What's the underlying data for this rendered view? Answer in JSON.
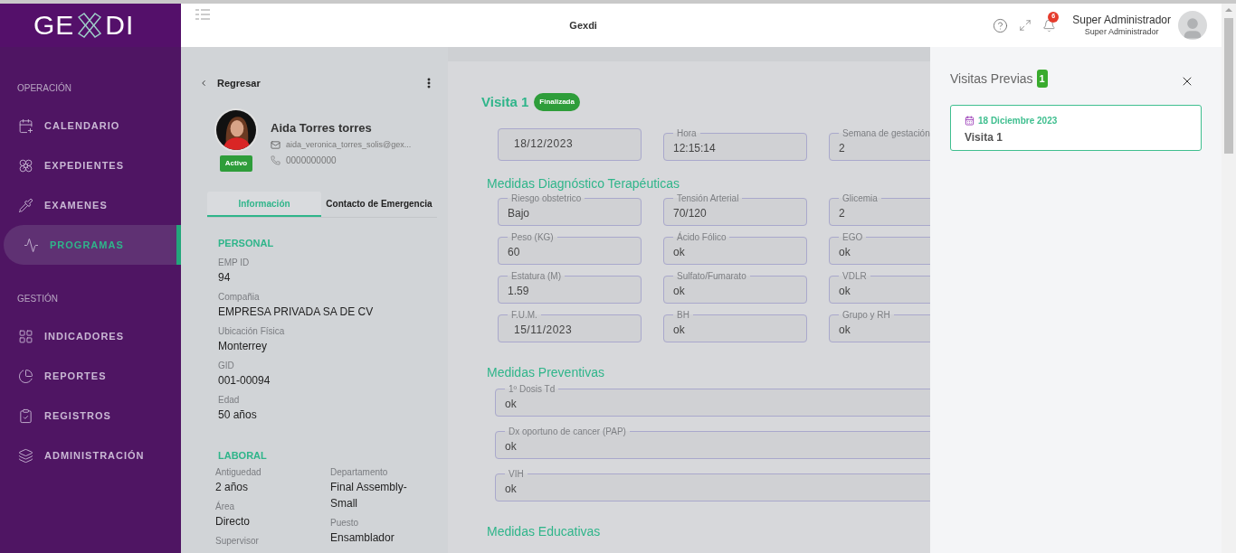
{
  "sidebar": {
    "logo": [
      "GE",
      "DI"
    ],
    "sections": [
      {
        "title": "OPERACIÓN",
        "items": [
          {
            "label": "CALENDARIO",
            "selected": false
          },
          {
            "label": "EXPEDIENTES",
            "selected": false
          },
          {
            "label": "EXAMENES",
            "selected": false
          },
          {
            "label": "PROGRAMAS",
            "selected": true
          }
        ]
      },
      {
        "title": "GESTIÓN",
        "items": [
          {
            "label": "INDICADORES",
            "selected": false
          },
          {
            "label": "REPORTES",
            "selected": false
          },
          {
            "label": "REGISTROS",
            "selected": false
          },
          {
            "label": "ADMINISTRACIÓN",
            "selected": false
          }
        ]
      }
    ]
  },
  "header": {
    "title": "Gexdi",
    "notifications": "6",
    "user_name": "Super Administrador",
    "user_role": "Super Administrador"
  },
  "profile": {
    "back": "Regresar",
    "name": "Aida Torres torres",
    "email": "aida_veronica_torres_solis@gex...",
    "phone": "0000000000",
    "status": "Activo",
    "tabs": [
      {
        "label": "Información",
        "selected": true
      },
      {
        "label": "Contacto de Emergencia",
        "selected": false
      }
    ],
    "personal": {
      "title": "PERSONAL",
      "fields": [
        {
          "label": "EMP ID",
          "value": "94"
        },
        {
          "label": "Compañia",
          "value": "EMPRESA PRIVADA SA DE CV"
        },
        {
          "label": "Ubicación Física",
          "value": "Monterrey"
        },
        {
          "label": "GID",
          "value": "001-00094"
        },
        {
          "label": "Edad",
          "value": "50 años"
        }
      ]
    },
    "laboral": {
      "title": "LABORAL",
      "columns": [
        [
          {
            "label": "Antiguedad",
            "value": "2 años"
          },
          {
            "label": "Área",
            "value": "Directo"
          },
          {
            "label": "Supervisor"
          }
        ],
        [
          {
            "label": "Departamento",
            "value": "Final Assembly-Small"
          },
          {
            "label": "Puesto",
            "value": "Ensamblador"
          }
        ]
      ]
    }
  },
  "visit": {
    "title": "Visita 1",
    "status": "Finalizada",
    "top_fields": [
      {
        "value": "18/12/2023",
        "kind": "date"
      },
      {
        "label": "Hora",
        "value": "12:15:14",
        "kind": "text"
      },
      {
        "label": "Semana de gestación",
        "value": "2",
        "kind": "text"
      }
    ],
    "sections": [
      {
        "title": "Medidas Diagnóstico Terapéuticas",
        "kind": "grid",
        "fields": [
          {
            "label": "Riesgo obstetrico",
            "value": "Bajo",
            "kind": "text"
          },
          {
            "label": "Tensión Arterial",
            "value": "70/120",
            "kind": "text"
          },
          {
            "label": "Glicemia",
            "value": "2",
            "kind": "text"
          },
          {
            "label": "Peso (KG)",
            "value": "60",
            "kind": "text"
          },
          {
            "label": "Ácido Fólico",
            "value": "ok",
            "kind": "text"
          },
          {
            "label": "EGO",
            "value": "ok",
            "kind": "text"
          },
          {
            "label": "Estatura (M)",
            "value": "1.59",
            "kind": "text"
          },
          {
            "label": "Sulfato/Fumarato",
            "value": "ok",
            "kind": "text"
          },
          {
            "label": "VDLR",
            "value": "ok",
            "kind": "text"
          },
          {
            "label": "F.U.M.",
            "value": "15/11/2023",
            "kind": "date"
          },
          {
            "label": "BH",
            "value": "ok",
            "kind": "text"
          },
          {
            "label": "Grupo y RH",
            "value": "ok",
            "kind": "text"
          }
        ]
      },
      {
        "title": "Medidas Preventivas",
        "kind": "full",
        "fields": [
          {
            "label": "1º Dosis Td",
            "value": "ok",
            "kind": "text"
          },
          {
            "label": "Dx oportuno de cancer (PAP)",
            "value": "ok",
            "kind": "text"
          },
          {
            "label": "VIH",
            "value": "ok",
            "kind": "text"
          }
        ]
      },
      {
        "title": "Medidas Educativas",
        "kind": "full"
      }
    ]
  },
  "drawer": {
    "title": "Visitas Previas",
    "count": "1",
    "visits": [
      {
        "date": "18 Diciembre 2023",
        "title": "Visita 1"
      }
    ]
  }
}
